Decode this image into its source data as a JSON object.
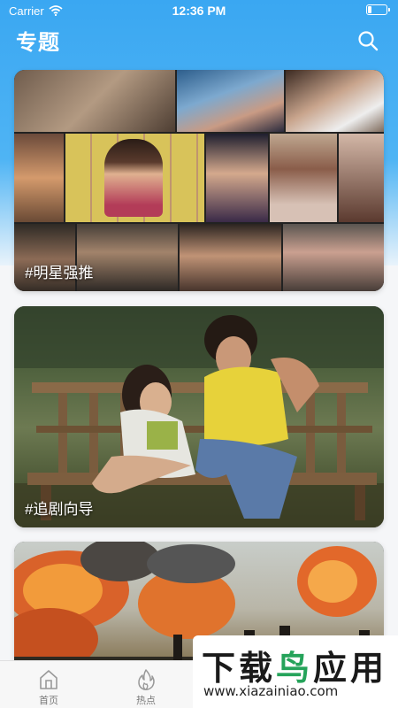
{
  "status_bar": {
    "carrier": "Carrier",
    "time": "12:36 PM"
  },
  "header": {
    "title": "专题"
  },
  "cards": [
    {
      "tag": "#明星强推"
    },
    {
      "tag": "#追剧向导"
    },
    {
      "tag": ""
    }
  ],
  "tab_bar": {
    "items": [
      {
        "label": "首页",
        "icon": "home-icon"
      },
      {
        "label": "热点",
        "icon": "flame-icon"
      }
    ]
  },
  "watermark": {
    "logo_part1": "下载",
    "logo_part2": "鸟",
    "logo_part3": "应用",
    "url": "www.xiazainiao.com"
  },
  "colors": {
    "header_blue": "#3aa7f2",
    "watermark_green": "#25a35a"
  }
}
